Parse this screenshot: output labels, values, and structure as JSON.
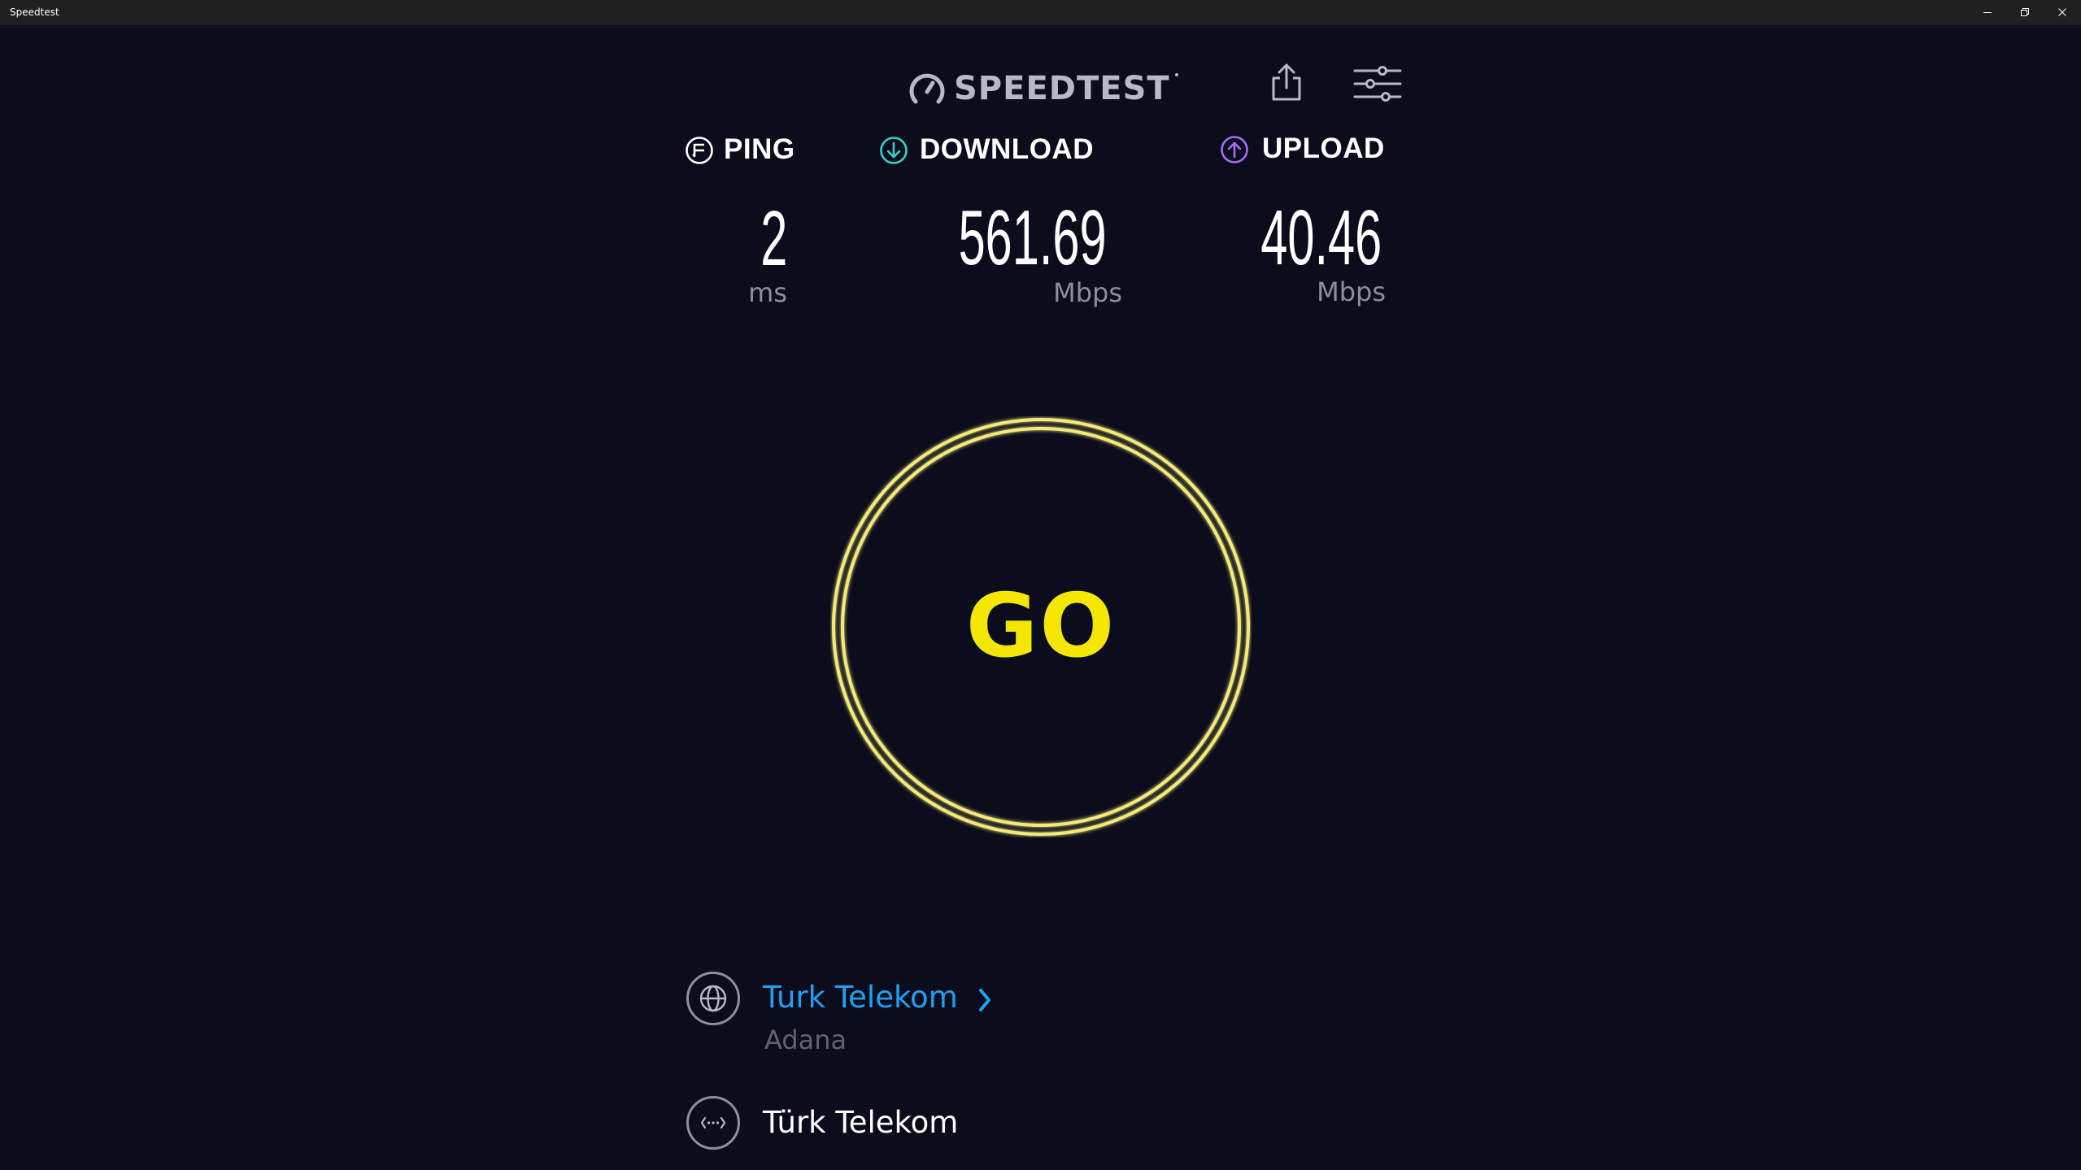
{
  "window": {
    "title": "Speedtest"
  },
  "logo": {
    "text": "SPEEDTEST"
  },
  "toolbar": {
    "share_icon": "share-icon",
    "settings_icon": "settings-sliders-icon"
  },
  "metrics": {
    "ping": {
      "label": "PING",
      "value": "2",
      "unit": "ms",
      "icon": "ping-icon",
      "color": "#ffffff"
    },
    "download": {
      "label": "DOWNLOAD",
      "value": "561.69",
      "unit": "Mbps",
      "icon": "download-arrow-icon",
      "color": "#37d0c8"
    },
    "upload": {
      "label": "UPLOAD",
      "value": "40.46",
      "unit": "Mbps",
      "icon": "upload-arrow-icon",
      "color": "#a66df5"
    }
  },
  "go_button": {
    "label": "GO",
    "ring_color": "#f3ea7a",
    "text_color": "#f4e600"
  },
  "server": {
    "icon": "globe-icon",
    "name": "Turk Telekom",
    "location": "Adana",
    "name_color": "#1da1f2"
  },
  "isp": {
    "icon": "connection-dots-icon",
    "name": "Türk Telekom"
  },
  "colors": {
    "background": "#0b0c1c",
    "titlebar": "#1f1f1f",
    "muted": "#8b8f9e"
  }
}
